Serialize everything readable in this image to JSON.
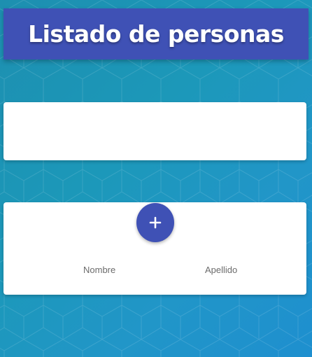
{
  "header": {
    "title": "Listado de personas"
  },
  "form_card": {},
  "list_card": {
    "add_button_icon": "plus-icon",
    "columns": [
      "Nombre",
      "Apellido"
    ],
    "rows": []
  },
  "colors": {
    "primary": "#3f51b5",
    "background": "#1c98b9",
    "card": "#ffffff",
    "column_text": "#6b6b6b"
  }
}
